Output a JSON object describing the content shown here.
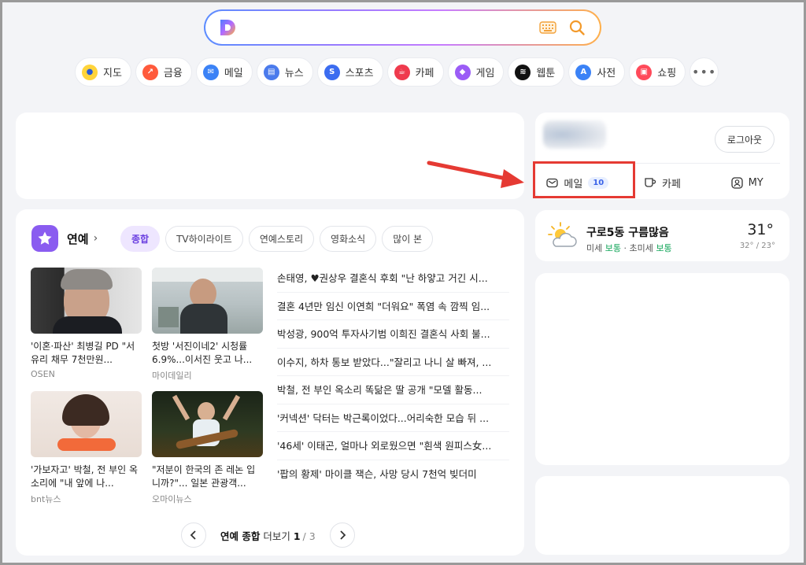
{
  "search": {
    "placeholder": ""
  },
  "shortcuts": [
    {
      "label": "지도",
      "icon": "map-pin-icon",
      "color": "#ffd43b"
    },
    {
      "label": "금융",
      "icon": "finance-trend-icon",
      "color": "#ff5a3c"
    },
    {
      "label": "메일",
      "icon": "mail-icon",
      "color": "#3b82f6"
    },
    {
      "label": "뉴스",
      "icon": "news-icon",
      "color": "#4b7bec"
    },
    {
      "label": "스포츠",
      "icon": "sports-icon",
      "color": "#3b6cf0"
    },
    {
      "label": "카페",
      "icon": "cafe-icon",
      "color": "#ef3a4d"
    },
    {
      "label": "게임",
      "icon": "game-icon",
      "color": "#9b5cf6"
    },
    {
      "label": "웹툰",
      "icon": "webtoon-icon",
      "color": "#111111"
    },
    {
      "label": "사전",
      "icon": "dictionary-icon",
      "color": "#3b82f6"
    },
    {
      "label": "쇼핑",
      "icon": "shopping-bag-icon",
      "color": "#ff4a5a"
    }
  ],
  "more_label": "•••",
  "login": {
    "logout_label": "로그아웃",
    "mail_label": "메일",
    "mail_count": "10",
    "cafe_label": "카페",
    "my_label": "MY"
  },
  "weather": {
    "title": "구로5동 구름많음",
    "dust_label": "미세",
    "dust_value": "보통",
    "fine_dust_label": "초미세",
    "fine_dust_value": "보통",
    "sep": "·",
    "temp": "31°",
    "range": "32° / 23°",
    "icon": "partly-cloudy-icon"
  },
  "entertainment": {
    "title": "연예",
    "tabs": [
      "종합",
      "TV하이라이트",
      "연예스토리",
      "영화소식",
      "많이 본"
    ],
    "cards": [
      {
        "title": "'이혼·파산' 최병길 PD \"서유리 채무 7천만원...",
        "source": "OSEN"
      },
      {
        "title": "첫방 '서진이네2' 시청률 6.9%...이서진 웃고 나...",
        "source": "마이데일리"
      },
      {
        "title": "'가보자고' 박철, 전 부인 옥소리에 \"내 앞에 나...",
        "source": "bnt뉴스"
      },
      {
        "title": "\"저분이 한국의 존 레논 입니까?\"... 일본 관광객...",
        "source": "오마이뉴스"
      }
    ],
    "headlines": [
      "손태영, ♥권상우 결혼식 후회 \"난 하얗고 거긴 시...",
      "결혼 4년만 임신 이연희 \"더워요\" 폭염 속 깜찍 임...",
      "박성광, 900억 투자사기범 이희진 결혼식 사회 불...",
      "이수지, 하차 통보 받았다...\"잘리고 나니 살 빠져, ...",
      "박철, 전 부인 옥소리 똑닮은 딸 공개 \"모델 활동...",
      "'커넥션' 닥터는 박근록이었다...어리숙한 모습 뒤 ...",
      "'46세' 이태곤, 얼마나 외로웠으면 \"흰색 원피스女...",
      "'팝의 황제' 마이클 잭슨, 사망 당시 7천억 빚더미"
    ],
    "pager": {
      "label": "연예 종합",
      "more": "더보기",
      "current": "1",
      "total": "/ 3"
    }
  }
}
